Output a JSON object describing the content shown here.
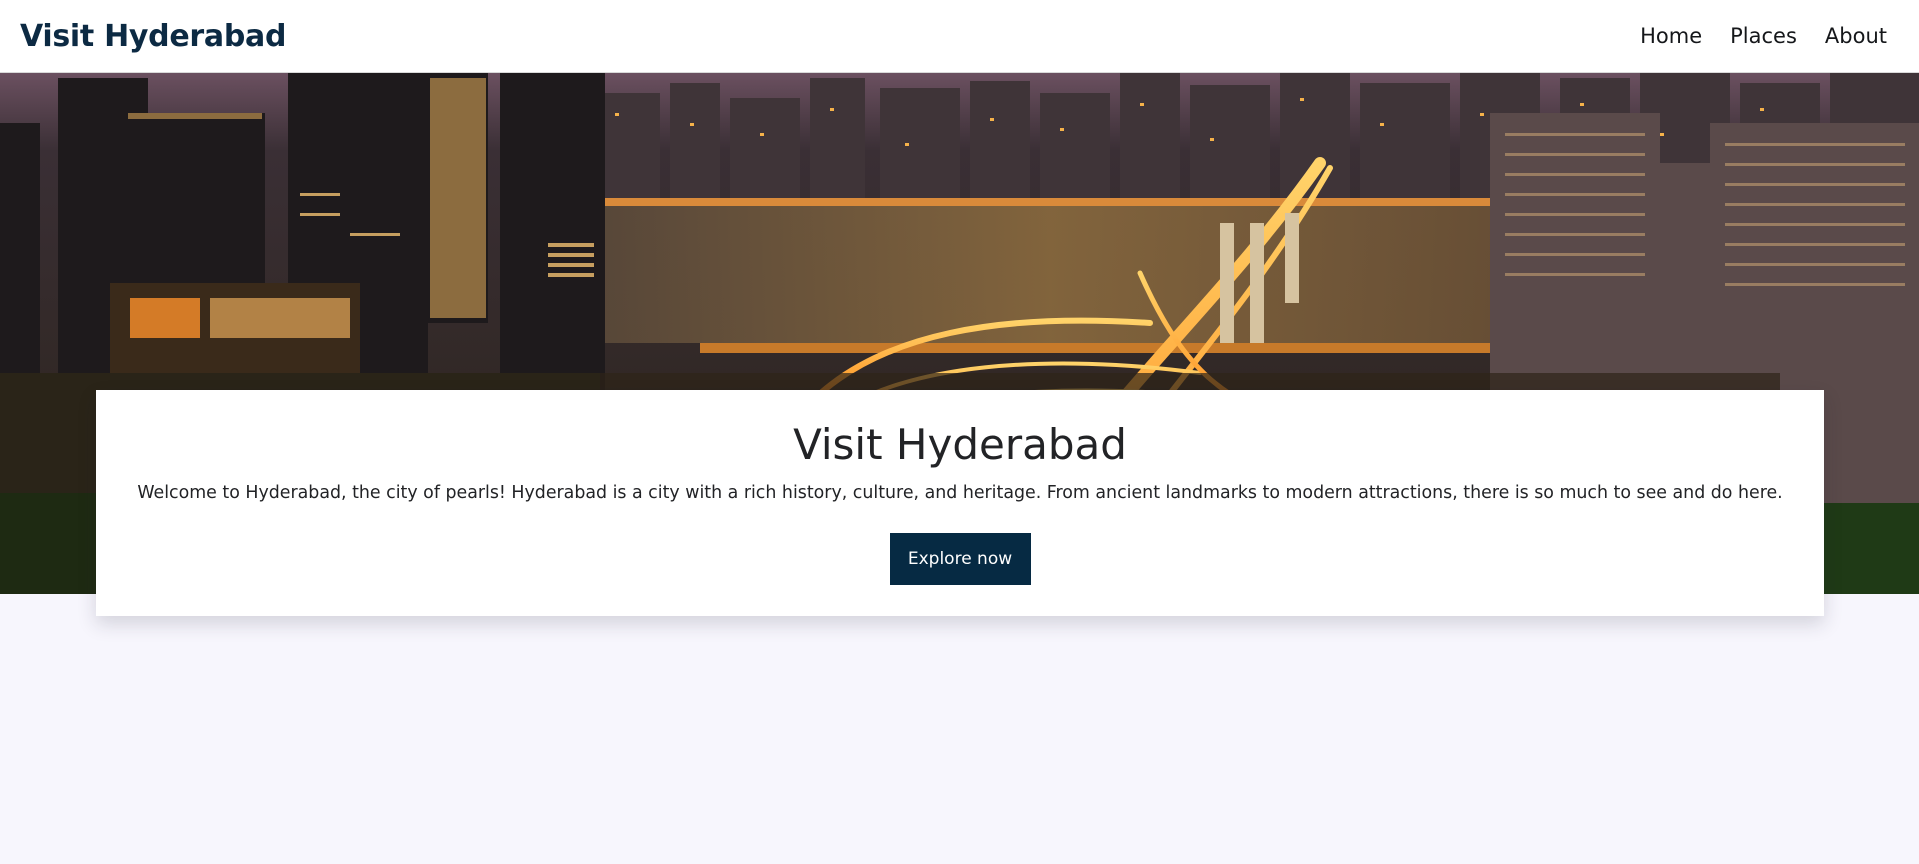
{
  "nav": {
    "brand": "Visit Hyderabad",
    "links": [
      "Home",
      "Places",
      "About"
    ]
  },
  "hero": {
    "image": "night city skyline with illuminated highway interchange and river"
  },
  "card": {
    "title": "Visit Hyderabad",
    "description": "Welcome to Hyderabad, the city of pearls! Hyderabad is a city with a rich history, culture, and heritage. From ancient landmarks to modern attractions, there is so much to see and do here.",
    "button_label": "Explore now"
  },
  "colors": {
    "brand": "#0c2a43",
    "button": "#062a43",
    "page_background": "#f7f6fd"
  }
}
